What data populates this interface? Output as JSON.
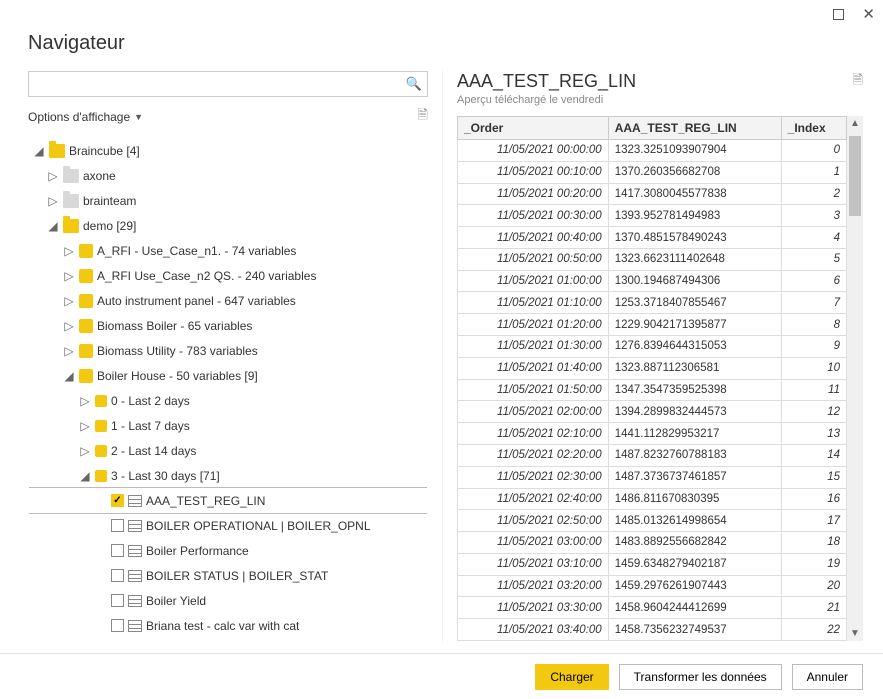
{
  "window": {
    "title": "Navigateur"
  },
  "search": {
    "placeholder": ""
  },
  "options": {
    "label": "Options d'affichage"
  },
  "tree": {
    "root": {
      "label": "Braincube [4]"
    },
    "axone": {
      "label": "axone"
    },
    "brainteam": {
      "label": "brainteam"
    },
    "demo": {
      "label": "demo [29]"
    },
    "rfi1": {
      "label": "A_RFI - Use_Case_n1. - 74 variables"
    },
    "rfi2": {
      "label": "A_RFI Use_Case_n2 QS. - 240 variables"
    },
    "auto": {
      "label": "Auto instrument panel - 647 variables"
    },
    "bboiler": {
      "label": "Biomass Boiler - 65 variables"
    },
    "butil": {
      "label": "Biomass Utility - 783 variables"
    },
    "bhouse": {
      "label": "Boiler House - 50 variables [9]"
    },
    "d0": {
      "label": "0 - Last 2 days"
    },
    "d1": {
      "label": "1 - Last 7 days"
    },
    "d2": {
      "label": "2 - Last 14 days"
    },
    "d3": {
      "label": "3 - Last 30 days [71]"
    },
    "t_aaa": {
      "label": "AAA_TEST_REG_LIN"
    },
    "t_opnl": {
      "label": "BOILER OPERATIONAL | BOILER_OPNL"
    },
    "t_perf": {
      "label": "Boiler Performance"
    },
    "t_stat": {
      "label": "BOILER STATUS | BOILER_STAT"
    },
    "t_yield": {
      "label": "Boiler Yield"
    },
    "t_briana": {
      "label": "Briana test - calc var with cat"
    }
  },
  "preview": {
    "title": "AAA_TEST_REG_LIN",
    "subtitle": "Aperçu téléchargé le vendredi",
    "columns": {
      "order": "_Order",
      "val": "AAA_TEST_REG_LIN",
      "idx": "_Index"
    },
    "rows": [
      {
        "order": "11/05/2021 00:00:00",
        "val": "1323.3251093907904",
        "idx": "0"
      },
      {
        "order": "11/05/2021 00:10:00",
        "val": "1370.260356682708",
        "idx": "1"
      },
      {
        "order": "11/05/2021 00:20:00",
        "val": "1417.3080045577838",
        "idx": "2"
      },
      {
        "order": "11/05/2021 00:30:00",
        "val": "1393.952781494983",
        "idx": "3"
      },
      {
        "order": "11/05/2021 00:40:00",
        "val": "1370.4851578490243",
        "idx": "4"
      },
      {
        "order": "11/05/2021 00:50:00",
        "val": "1323.6623111402648",
        "idx": "5"
      },
      {
        "order": "11/05/2021 01:00:00",
        "val": "1300.194687494306",
        "idx": "6"
      },
      {
        "order": "11/05/2021 01:10:00",
        "val": "1253.3718407855467",
        "idx": "7"
      },
      {
        "order": "11/05/2021 01:20:00",
        "val": "1229.9042171395877",
        "idx": "8"
      },
      {
        "order": "11/05/2021 01:30:00",
        "val": "1276.8394644315053",
        "idx": "9"
      },
      {
        "order": "11/05/2021 01:40:00",
        "val": "1323.887112306581",
        "idx": "10"
      },
      {
        "order": "11/05/2021 01:50:00",
        "val": "1347.3547359525398",
        "idx": "11"
      },
      {
        "order": "11/05/2021 02:00:00",
        "val": "1394.2899832444573",
        "idx": "12"
      },
      {
        "order": "11/05/2021 02:10:00",
        "val": "1441.112829953217",
        "idx": "13"
      },
      {
        "order": "11/05/2021 02:20:00",
        "val": "1487.8232760788183",
        "idx": "14"
      },
      {
        "order": "11/05/2021 02:30:00",
        "val": "1487.3736737461857",
        "idx": "15"
      },
      {
        "order": "11/05/2021 02:40:00",
        "val": "1486.811670830395",
        "idx": "16"
      },
      {
        "order": "11/05/2021 02:50:00",
        "val": "1485.0132614998654",
        "idx": "17"
      },
      {
        "order": "11/05/2021 03:00:00",
        "val": "1483.8892556682842",
        "idx": "18"
      },
      {
        "order": "11/05/2021 03:10:00",
        "val": "1459.6348279402187",
        "idx": "19"
      },
      {
        "order": "11/05/2021 03:20:00",
        "val": "1459.2976261907443",
        "idx": "20"
      },
      {
        "order": "11/05/2021 03:30:00",
        "val": "1458.9604244412699",
        "idx": "21"
      },
      {
        "order": "11/05/2021 03:40:00",
        "val": "1458.7356232749537",
        "idx": "22"
      }
    ]
  },
  "buttons": {
    "load": "Charger",
    "transform": "Transformer les données",
    "cancel": "Annuler"
  }
}
